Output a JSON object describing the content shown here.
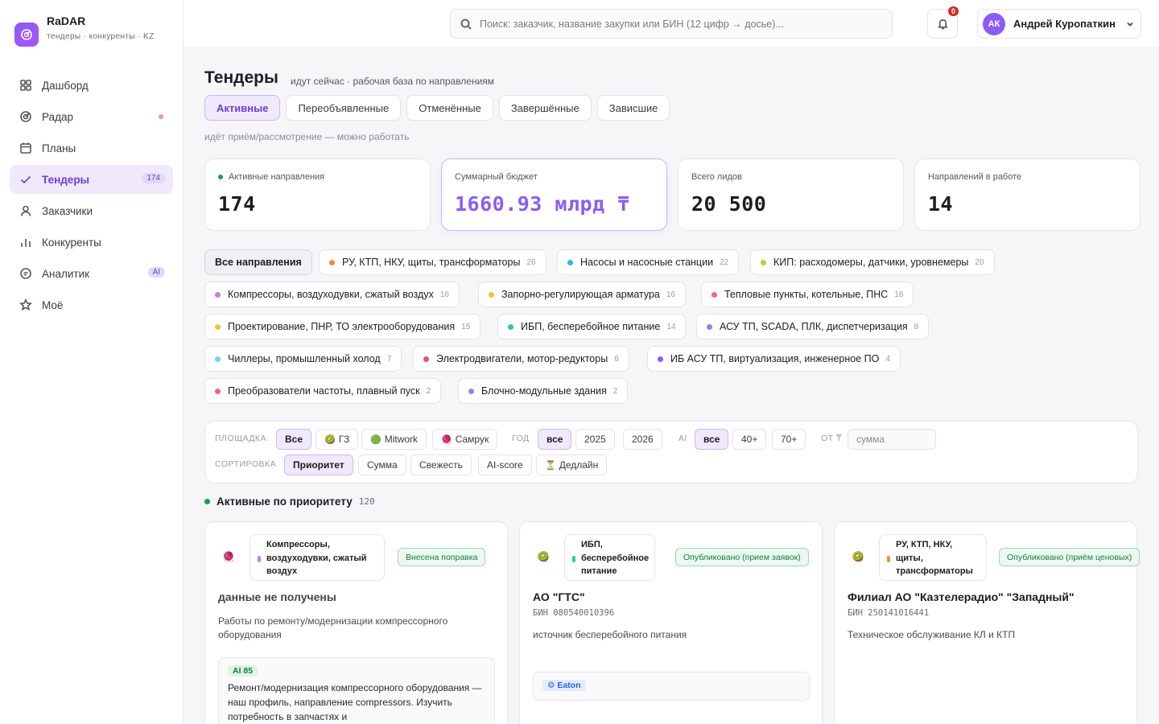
{
  "app": {
    "name": "RaDAR",
    "subtitle": "тендеры · конкуренты · KZ"
  },
  "sidebar": {
    "items": [
      {
        "label": "Дашборд",
        "icon": "grid-icon"
      },
      {
        "label": "Радар",
        "icon": "radar-icon"
      },
      {
        "label": "Планы",
        "icon": "calendar-icon"
      },
      {
        "label": "Тендеры",
        "icon": "check-icon",
        "badge": "174",
        "active": true
      },
      {
        "label": "Заказчики",
        "icon": "user-icon"
      },
      {
        "label": "Конкуренты",
        "icon": "bar-chart-icon"
      },
      {
        "label": "Аналитик",
        "icon": "chat-icon",
        "badge": "AI"
      },
      {
        "label": "Моё",
        "icon": "star-icon"
      }
    ]
  },
  "topbar": {
    "search_placeholder": "Поиск: заказчик, название закупки или БИН (12 цифр → досье)...",
    "notifications": "0",
    "user_initials": "АК",
    "user_name": "Андрей Куропаткин"
  },
  "page": {
    "title": "Тендеры",
    "subtitle": "идут сейчас · рабочая база по направлениям",
    "tabs": [
      "Активные",
      "Переобъявленные",
      "Отменённые",
      "Завершённые",
      "Зависшие"
    ],
    "tab_hint": "идёт приём/рассмотрение — можно работать"
  },
  "kpis": [
    {
      "label": "Активные направления",
      "value": "174"
    },
    {
      "label": "Суммарный бюджет",
      "value": "1660.93 млрд ₸"
    },
    {
      "label": "Всего лидов",
      "value": "20 500"
    },
    {
      "label": "Направлений в работе",
      "value": "14"
    }
  ],
  "directions": [
    {
      "label": "Все направления",
      "count": "",
      "color": ""
    },
    {
      "label": "РУ, КТП, НКУ, щиты, трансформаторы",
      "count": "26",
      "color": "#f28c38"
    },
    {
      "label": "Насосы и насосные станции",
      "count": "22",
      "color": "#38b2e8"
    },
    {
      "label": "КИП: расходомеры, датчики, уровнемеры",
      "count": "20",
      "color": "#a3d93f"
    },
    {
      "label": "Компрессоры, воздуходувки, сжатый воздух",
      "count": "16",
      "color": "#c084e8"
    },
    {
      "label": "Запорно-регулирующая арматура",
      "count": "16",
      "color": "#f2c230"
    },
    {
      "label": "Тепловые пункты, котельные, ПНС",
      "count": "16",
      "color": "#f06b7a"
    },
    {
      "label": "Проектирование, ПНР, ТО электрооборудования",
      "count": "15",
      "color": "#f2c230"
    },
    {
      "label": "ИБП, бесперебойное питание",
      "count": "14",
      "color": "#2cc9a8"
    },
    {
      "label": "АСУ ТП, SCADA, ПЛК, диспетчеризация",
      "count": "8",
      "color": "#7c8ae8"
    },
    {
      "label": "Чиллеры, промышленный холод",
      "count": "7",
      "color": "#6ad9ea"
    },
    {
      "label": "Электродвигатели, мотор-редукторы",
      "count": "6",
      "color": "#ef4f5f"
    },
    {
      "label": "ИБ АСУ ТП, виртуализация, инженерное ПО",
      "count": "4",
      "color": "#8b5cf6"
    },
    {
      "label": "Преобразователи частоты, плавный пуск",
      "count": "2",
      "color": "#ec5f9e"
    },
    {
      "label": "Блочно-модульные здания",
      "count": "2",
      "color": "#a37ef0"
    }
  ],
  "filters": {
    "platform_label": "ПЛОЩАДКА",
    "platforms": [
      {
        "label": "Все",
        "icon": ""
      },
      {
        "label": "ГЗ",
        "icon": "🥝"
      },
      {
        "label": "Mitwork",
        "icon": "🟢"
      },
      {
        "label": "Самрук",
        "icon": "🧶"
      }
    ],
    "year_label": "ГОД",
    "years": [
      "все",
      "2025",
      "2026"
    ],
    "ai_label": "AI",
    "ai_options": [
      "все",
      "40+",
      "70+"
    ],
    "from_label": "ОТ ₸",
    "amount_placeholder": "сумма",
    "sort_label": "СОРТИРОВКА",
    "sorts": [
      {
        "label": "Приоритет",
        "icon": ""
      },
      {
        "label": "Сумма",
        "icon": ""
      },
      {
        "label": "Свежесть",
        "icon": ""
      },
      {
        "label": "AI-score",
        "icon": ""
      },
      {
        "label": "Дедлайн",
        "icon": "⏳"
      }
    ]
  },
  "section": {
    "title": "Активные по приоритету",
    "count": "120"
  },
  "cards": [
    {
      "platform_icon": "🧶",
      "direction": "Компрессоры, воздуходувки, сжатый воздух",
      "direction_color": "#c084e8",
      "status": "Внесена поправка",
      "customer": "данные не получены",
      "bin": "",
      "description": "Работы по ремонту/модернизации компрессорного оборудования",
      "ai_score": "AI 85",
      "ai_text": "Ремонт/модернизация компрессорного оборудования — наш профиль, направление compressors. Изучить потребность в запчастях и",
      "brand": ""
    },
    {
      "platform_icon": "🥝",
      "direction": "ИБП, бесперебойное питание",
      "direction_color": "#2cc9a8",
      "status": "Опубликовано (прием заявок)",
      "customer": "АО \"ГТС\"",
      "bin": "БИН 080540010396",
      "description": "источник бесперебойного питания",
      "ai_score": "",
      "ai_text": "",
      "brand": "⚙ Eaton"
    },
    {
      "platform_icon": "🥝",
      "direction": "РУ, КТП, НКУ, щиты, трансформаторы",
      "direction_color": "#f28c38",
      "status": "Опубликовано (приём ценовых)",
      "customer": "Филиал АО \"Казтелерадио\" \"Западный\"",
      "bin": "БИН 250141016441",
      "description": "Техническое обслуживание КЛ и КТП",
      "ai_score": "",
      "ai_text": "",
      "brand": ""
    }
  ]
}
